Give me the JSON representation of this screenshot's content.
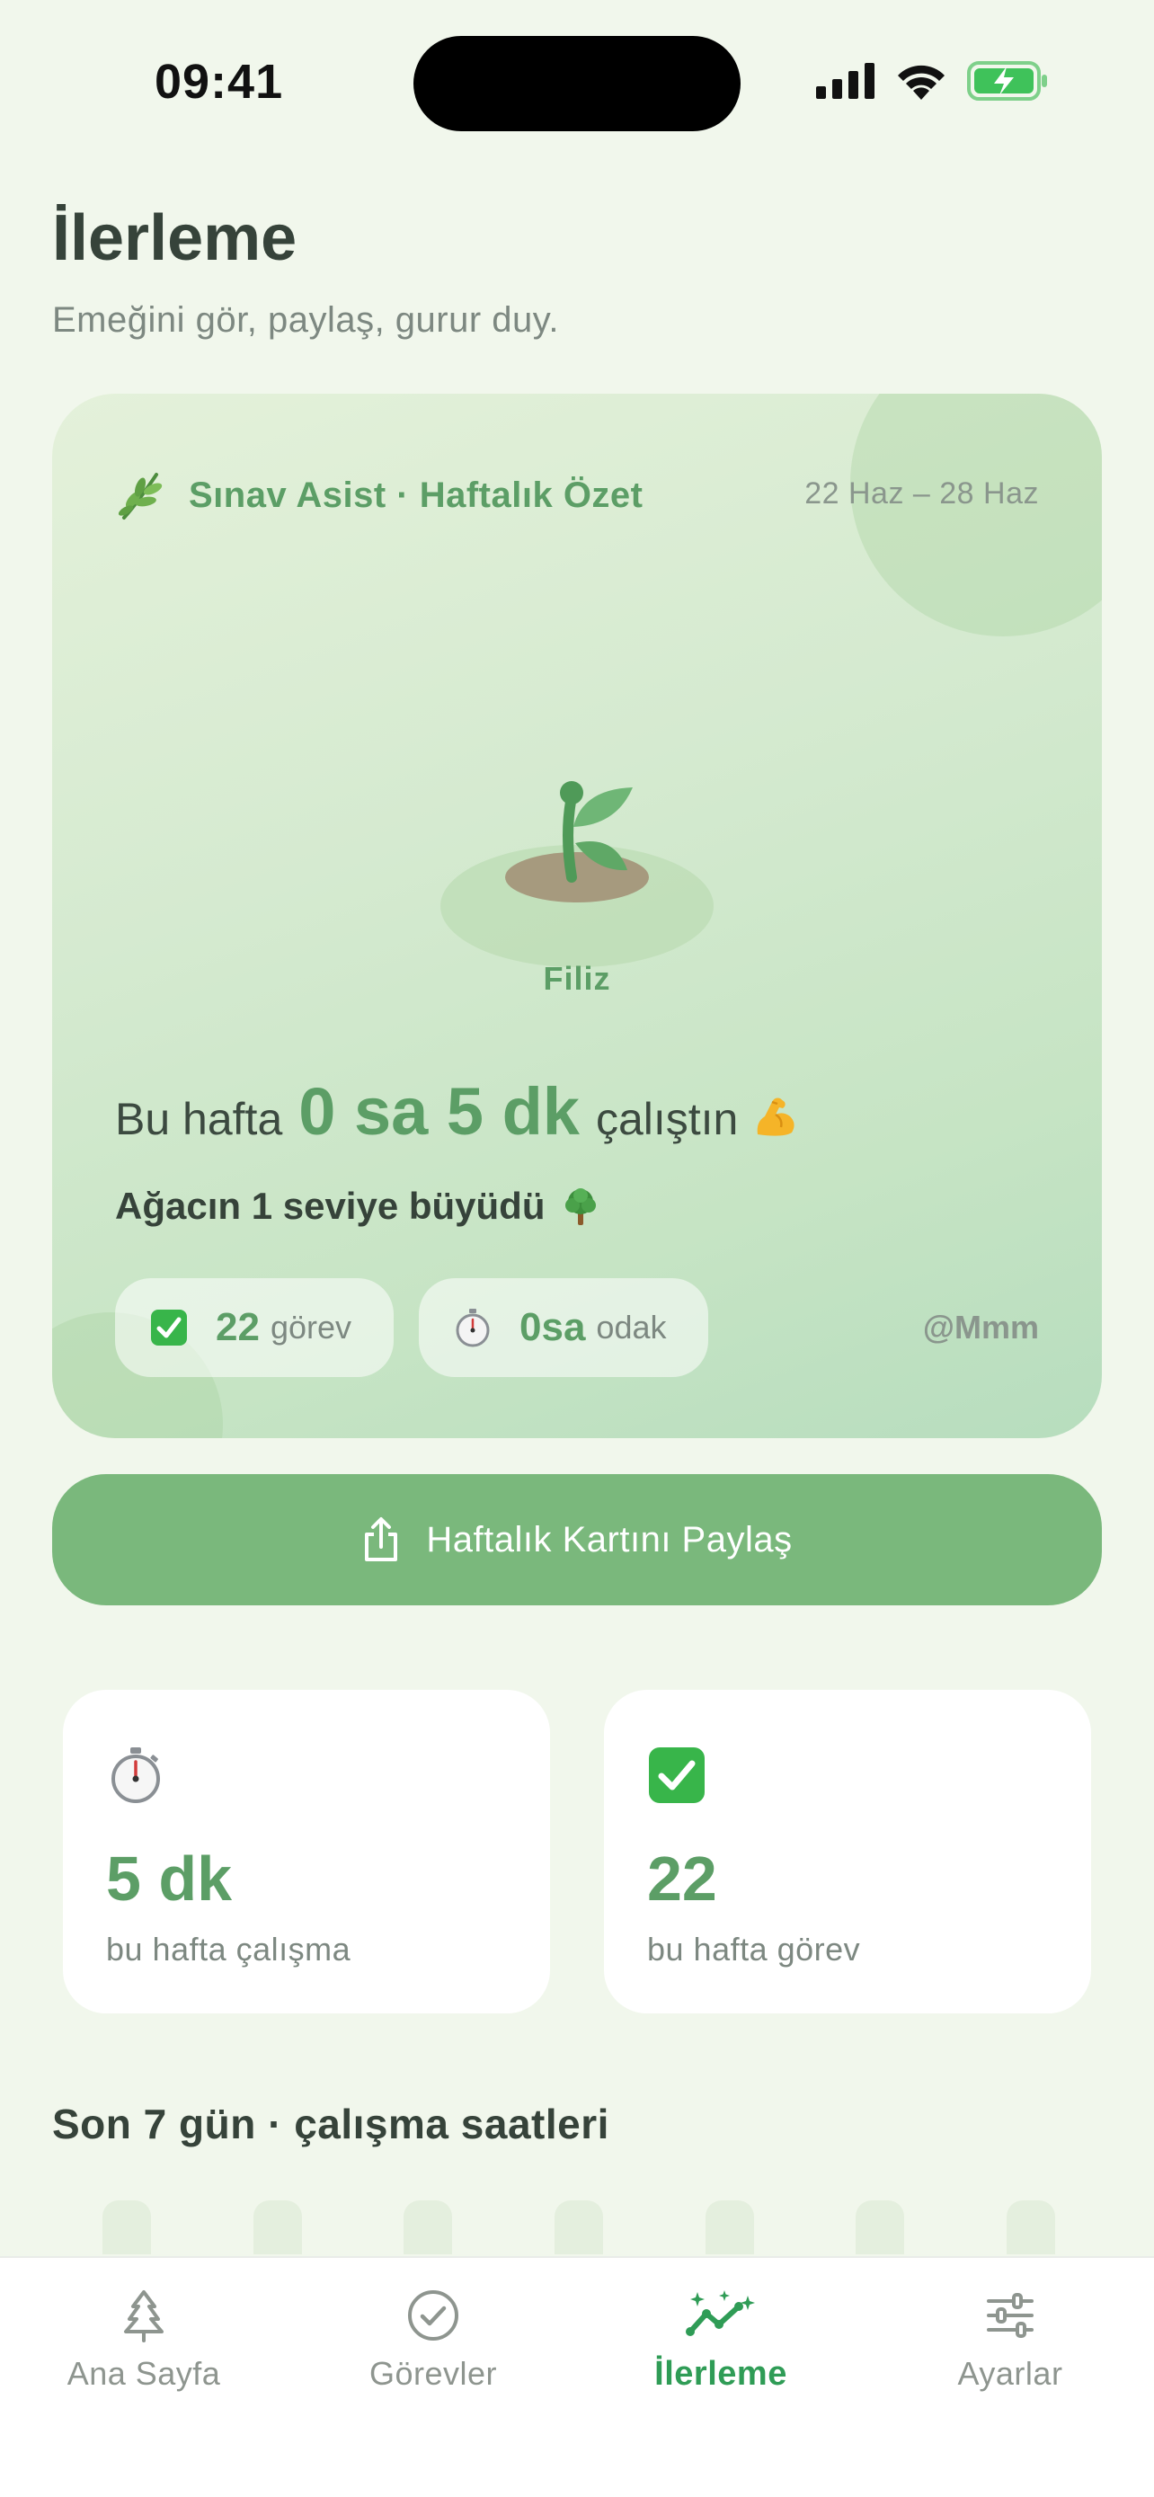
{
  "status_bar": {
    "time": "09:41"
  },
  "header": {
    "title": "İlerleme",
    "subtitle": "Emeğini gör, paylaş, gurur duy."
  },
  "week_card": {
    "brand": "Sınav Asist · Haftalık Özet",
    "date_range": "22 Haz – 28 Haz",
    "plant_level": "Filiz",
    "headline_pre": "Bu hafta",
    "headline_value": "0 sa 5 dk",
    "headline_post": "çalıştın",
    "growth_text": "Ağacın 1 seviye büyüdü",
    "tasks_chip": {
      "value": "22",
      "unit": "görev"
    },
    "focus_chip": {
      "value": "0sa",
      "unit": "odak"
    },
    "handle": "@Mmm"
  },
  "share_button": {
    "label": "Haftalık Kartını Paylaş"
  },
  "stats": [
    {
      "icon": "stopwatch-icon",
      "value": "5 dk",
      "label": "bu hafta çalışma"
    },
    {
      "icon": "check-box-icon",
      "value": "22",
      "label": "bu hafta görev"
    }
  ],
  "chart_section": {
    "title": "Son 7 gün · çalışma saatleri"
  },
  "tab_bar": {
    "items": [
      {
        "label": "Ana Sayfa",
        "icon": "tree-icon",
        "active": false
      },
      {
        "label": "Görevler",
        "icon": "check-circle-icon",
        "active": false
      },
      {
        "label": "İlerleme",
        "icon": "sparkle-trend-icon",
        "active": true
      },
      {
        "label": "Ayarlar",
        "icon": "sliders-icon",
        "active": false
      }
    ]
  },
  "colors": {
    "accent": "#5c9e66",
    "button": "#7ab87c",
    "active_tab": "#2f9c56",
    "background": "#f1f7ec"
  }
}
